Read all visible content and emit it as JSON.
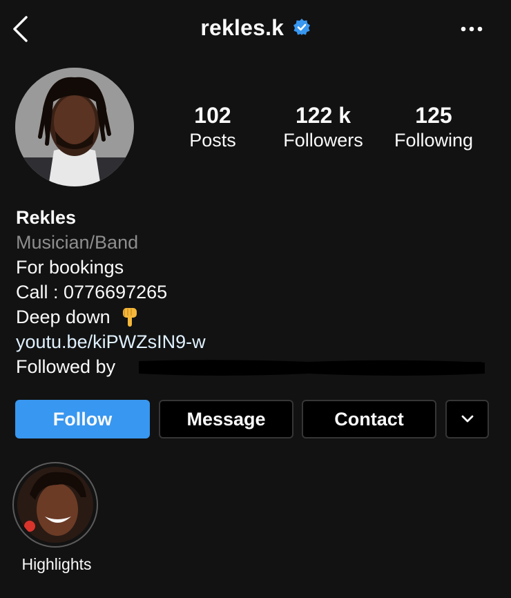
{
  "header": {
    "back_icon": "chevron-left-icon",
    "username": "rekles.k",
    "verified_icon": "verified-badge-icon",
    "more_icon": "more-horizontal-icon"
  },
  "stats": [
    {
      "value": "102",
      "label": "Posts"
    },
    {
      "value": "122 k",
      "label": "Followers"
    },
    {
      "value": "125",
      "label": "Following"
    }
  ],
  "bio": {
    "name": "Rekles",
    "category": "Musician/Band",
    "lines": [
      "For bookings",
      "Call : 0776697265",
      "Deep down"
    ],
    "emoji": "pointing-down-emoji",
    "link": "youtu.be/kiPWZsIN9-w",
    "followed_by": "Followed by"
  },
  "actions": {
    "follow": "Follow",
    "message": "Message",
    "contact": "Contact",
    "more_icon": "chevron-down-icon"
  },
  "highlights": [
    {
      "label": "Highlights"
    }
  ],
  "colors": {
    "background": "#121212",
    "follow_button": "#3897f0",
    "verified": "#3897f0",
    "category_text": "#8e8e8e"
  }
}
